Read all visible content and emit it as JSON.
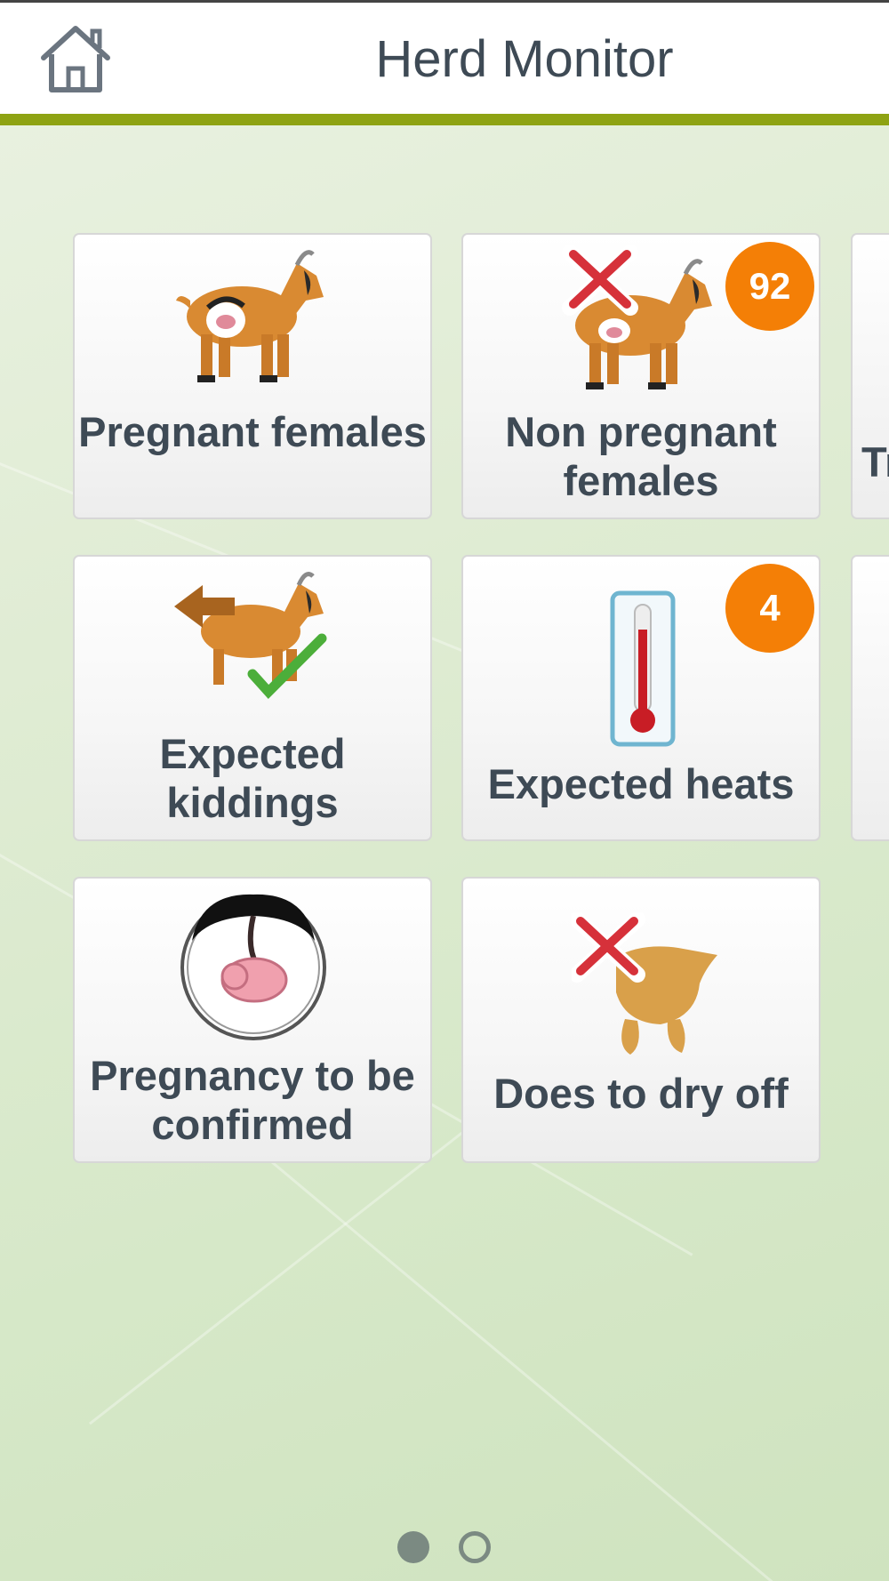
{
  "header": {
    "title": "Herd Monitor",
    "home_icon": "home-icon",
    "accent_color": "#8ea313"
  },
  "tiles": [
    {
      "label": "Pregnant females",
      "icon": "pregnant-goat-icon",
      "badge": null
    },
    {
      "label": "Non pregnant females",
      "icon": "non-pregnant-goat-icon",
      "badge": "92"
    },
    {
      "label": "Expected kiddings",
      "icon": "kidding-goat-icon",
      "badge": null
    },
    {
      "label": "Expected heats",
      "icon": "thermometer-icon",
      "badge": "4"
    },
    {
      "label": "Pregnancy to be confirmed",
      "icon": "fetus-icon",
      "badge": null
    },
    {
      "label": "Does to dry off",
      "icon": "udder-cross-icon",
      "badge": null
    }
  ],
  "next_page_partial_label": "Tr",
  "badge_color": "#f47f06",
  "pager": {
    "pages": 2,
    "current": 1
  }
}
